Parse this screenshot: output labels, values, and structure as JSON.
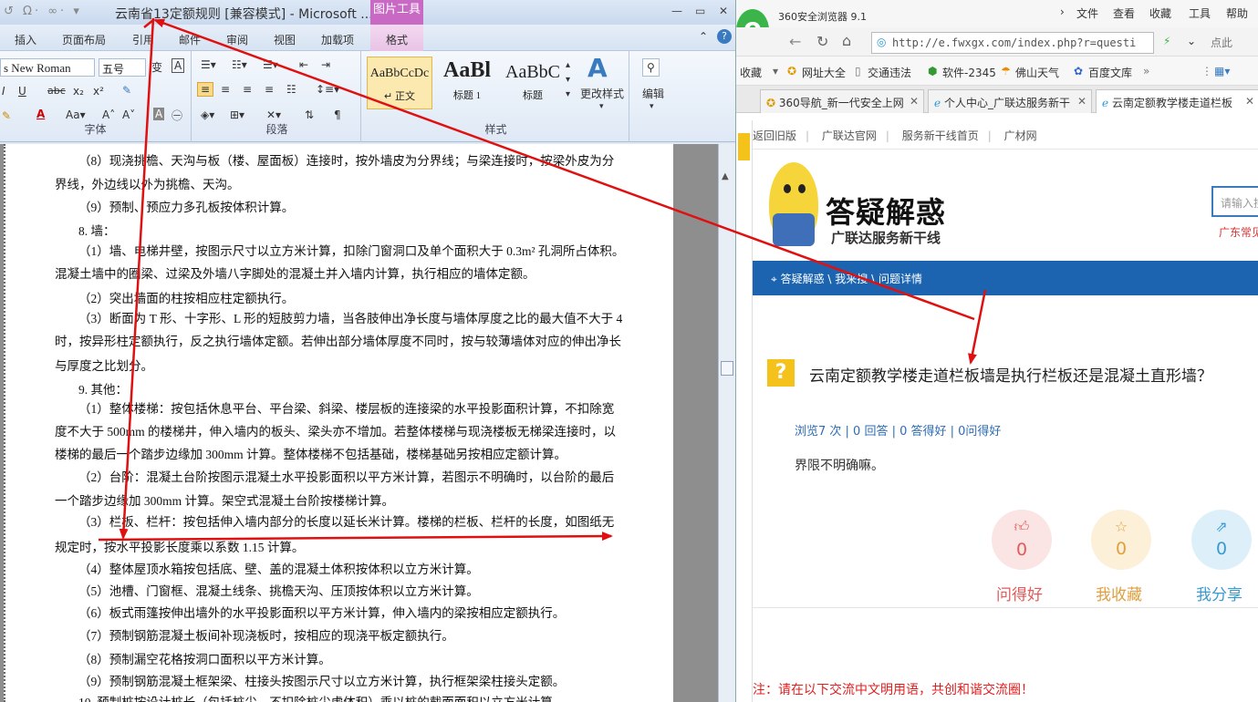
{
  "word": {
    "title": "云南省13定额规则 [兼容模式] - Microsoft ...",
    "context_tab_group": "图片工具",
    "tabs": [
      "插入",
      "页面布局",
      "引用",
      "邮件",
      "审阅",
      "视图",
      "加载项"
    ],
    "context_tab": "格式",
    "font_name": "s New Roman",
    "font_size": "五号",
    "group_labels": {
      "font": "字体",
      "paragraph": "段落",
      "styles": "样式"
    },
    "styles": [
      {
        "sample": "AaBbCcDc",
        "name": "↵ 正文"
      },
      {
        "sample": "AaBl",
        "name": "标题 1"
      },
      {
        "sample": "AaBbC",
        "name": "标题"
      }
    ],
    "change_styles": "更改样式",
    "edit": "编辑",
    "paragraphs": [
      "（8）现浇挑檐、天沟与板（楼、屋面板）连接时，按外墙皮为分界线；与梁连接时，按梁外皮为分",
      "界线，外边线以外为挑檐、天沟。",
      "（9）预制、预应力多孔板按体积计算。",
      "8. 墙：",
      "（1）墙、电梯井壁，按图示尺寸以立方米计算，扣除门窗洞口及单个面积大于 0.3m² 孔洞所占体积。",
      "混凝土墙中的圈梁、过梁及外墙八字脚处的混凝土并入墙内计算，执行相应的墙体定额。",
      "（2）突出墙面的柱按相应柱定额执行。",
      "（3）断面为 T 形、十字形、L 形的短肢剪力墙，当各肢伸出净长度与墙体厚度之比的最大值不大于 4",
      "时，按异形柱定额执行，反之执行墙体定额。若伸出部分墙体厚度不同时，按与较薄墙体对应的伸出净长",
      "与厚度之比划分。",
      "9. 其他：",
      "（1）整体楼梯：按包括休息平台、平台梁、斜梁、楼层板的连接梁的水平投影面积计算，不扣除宽",
      "度不大于 500mm 的楼梯井，伸入墙内的板头、梁头亦不增加。若整体楼梯与现浇楼板无梯梁连接时，以",
      "楼梯的最后一个踏步边缘加 300mm 计算。整体楼梯不包括基础，楼梯基础另按相应定额计算。",
      "（2）台阶：混凝土台阶按图示混凝土水平投影面积以平方米计算，若图示不明确时，以台阶的最后",
      "一个踏步边缘加 300mm 计算。架空式混凝土台阶按楼梯计算。",
      "（3）栏板、栏杆：按包括伸入墙内部分的长度以延长米计算。楼梯的栏板、栏杆的长度，如图纸无",
      "规定时，按水平投影长度乘以系数 1.15 计算。",
      "（4）整体屋顶水箱按包括底、壁、盖的混凝土体积按体积以立方米计算。",
      "（5）池槽、门窗框、混凝土线条、挑檐天沟、压顶按体积以立方米计算。",
      "（6）板式雨篷按伸出墙外的水平投影面积以平方米计算，伸入墙内的梁按相应定额执行。",
      "（7）预制钢筋混凝土板间补现浇板时，按相应的现浇平板定额执行。",
      "（8）预制漏空花格按洞口面积以平方米计算。",
      "（9）预制钢筋混凝土框架梁、柱接头按图示尺寸以立方米计算，执行框架梁柱接头定额。",
      "10. 预制桩按设计桩长（包括桩尖，不扣除桩尖虚体积）乘以桩的截面面积以立方米计算。"
    ]
  },
  "browser": {
    "title": "360安全浏览器 9.1",
    "menu": [
      "文件",
      "查看",
      "收藏",
      "工具",
      "帮助"
    ],
    "url": "http://e.fwxgx.com/index.php?r=questi",
    "right_link": "点此",
    "bookmarks": [
      "收藏",
      "网址大全",
      "交通违法",
      "软件-2345",
      "佛山天气",
      "百度文库"
    ],
    "tabs": [
      "360导航_新一代安全上网",
      "个人中心_广联达服务新干",
      "云南定额教学楼走道栏板"
    ],
    "top_links": [
      "返回旧版",
      "广联达官网",
      "服务新干线首页",
      "广材网"
    ],
    "logo_title": "答疑解惑",
    "logo_subtitle": "广联达服务新干线",
    "search_placeholder": "请输入搜",
    "guangdong_link": "广东常见",
    "breadcrumb": "答疑解惑 \\ 我来搜 \\ 问题详情",
    "question": "云南定额教学楼走道栏板墙是执行栏板还是混凝土直形墙？",
    "stats": "浏览7 次 | 0 回答 | 0 答得好 | 0问得好",
    "answer": "界限不明确嘛。",
    "actions": [
      {
        "count": "0",
        "label": "问得好",
        "color": "#e25a5a",
        "bg": "#fbe4e4"
      },
      {
        "count": "0",
        "label": "我收藏",
        "color": "#e0a040",
        "bg": "#fdf0d9"
      },
      {
        "count": "0",
        "label": "我分享",
        "color": "#3a9ad0",
        "bg": "#ddf0fa"
      }
    ],
    "notice": "注：请在以下交流中文明用语，共创和谐交流圈！"
  },
  "colors": {
    "arrow": "#e01010",
    "bluebar": "#1c64b0",
    "accent": "#f5c21b"
  }
}
